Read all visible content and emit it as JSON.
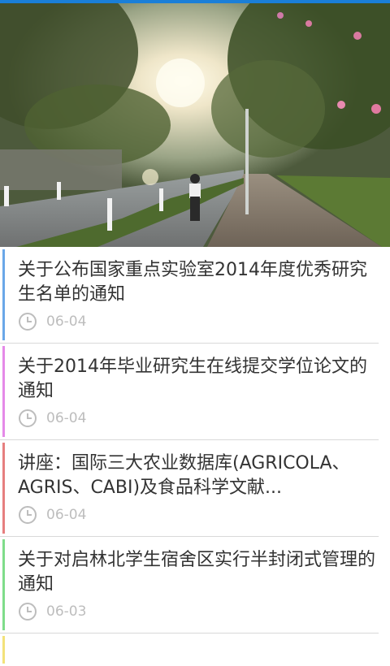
{
  "banner": {
    "description_icon": "campus-road-photo"
  },
  "news": [
    {
      "title": "关于公布国家重点实验室2014年度优秀研究生名单的通知",
      "date": "06-04",
      "accent": "#6aa7e8"
    },
    {
      "title": "关于2014年毕业研究生在线提交学位论文的通知",
      "date": "06-04",
      "accent": "#e58ae8"
    },
    {
      "title": "讲座：国际三大农业数据库(AGRICOLA、AGRIS、CABI)及食品科学文献...",
      "date": "06-04",
      "accent": "#e67f7f"
    },
    {
      "title": "关于对启林北学生宿舍区实行半封闭式管理的通知",
      "date": "06-03",
      "accent": "#7fdc8a"
    },
    {
      "title": "",
      "date": "",
      "accent": "#f3e27a"
    }
  ],
  "icons": {
    "clock": "clock-icon"
  }
}
